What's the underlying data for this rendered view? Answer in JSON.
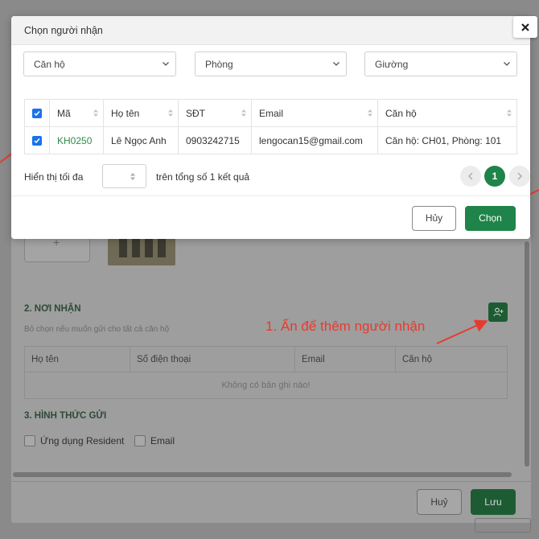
{
  "modal": {
    "title": "Chọn người nhận",
    "filters": [
      {
        "value": "Căn hộ"
      },
      {
        "value": "Phòng"
      },
      {
        "value": "Giường"
      }
    ],
    "table": {
      "columns": [
        "Mã",
        "Họ tên",
        "SĐT",
        "Email",
        "Căn hộ"
      ],
      "rows": [
        {
          "checked": true,
          "code": "KH0250",
          "name": "Lê Ngọc Anh",
          "phone": "0903242715",
          "email": "lengocan15@gmail.com",
          "apartment": "Căn hộ: CH01, Phòng: 101"
        }
      ]
    },
    "pagination": {
      "max_label": "Hiển thị tối đa",
      "total_label": "trên tổng số 1 kết quả",
      "current_page": "1"
    },
    "cancel_label": "Hủy",
    "choose_label": "Chọn"
  },
  "background": {
    "section2_title": "2. NƠI NHẬN",
    "section2_hint": "Bỏ chọn nếu muốn gửi cho tất cả căn hộ",
    "recipients_table": {
      "columns": [
        "Họ tên",
        "Số điện thoại",
        "Email",
        "Căn hộ"
      ],
      "empty_text": "Không có bản ghi nào!"
    },
    "section3_title": "3. HÌNH THỨC GỬI",
    "send_options": [
      "Ứng dụng Resident",
      "Email"
    ],
    "cancel_label": "Huỷ",
    "save_label": "Lưu"
  },
  "annotation": {
    "text": "1. Ấn để thêm người nhận",
    "color": "#e63b2e"
  },
  "colors": {
    "primary": "#1e8449",
    "checkbox": "#1a73e8",
    "link": "#2e8b4a"
  }
}
